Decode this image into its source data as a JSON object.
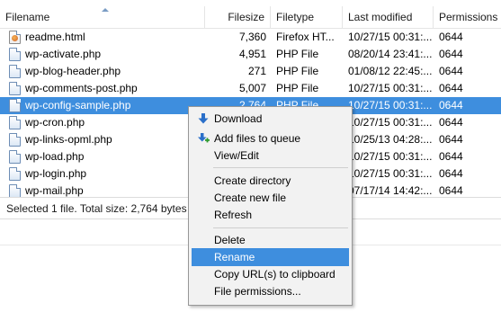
{
  "columns": {
    "filename": "Filename",
    "filesize": "Filesize",
    "filetype": "Filetype",
    "last_modified": "Last modified",
    "permissions": "Permissions"
  },
  "files": [
    {
      "name": "readme.html",
      "size": "7,360",
      "type": "Firefox HT...",
      "modified": "10/27/15 00:31:...",
      "perm": "0644",
      "icon": "html-file-icon"
    },
    {
      "name": "wp-activate.php",
      "size": "4,951",
      "type": "PHP File",
      "modified": "08/20/14 23:41:...",
      "perm": "0644",
      "icon": "php-file-icon"
    },
    {
      "name": "wp-blog-header.php",
      "size": "271",
      "type": "PHP File",
      "modified": "01/08/12 22:45:...",
      "perm": "0644",
      "icon": "php-file-icon"
    },
    {
      "name": "wp-comments-post.php",
      "size": "5,007",
      "type": "PHP File",
      "modified": "10/27/15 00:31:...",
      "perm": "0644",
      "icon": "php-file-icon"
    },
    {
      "name": "wp-config-sample.php",
      "size": "2,764",
      "type": "PHP File",
      "modified": "10/27/15 00:31:...",
      "perm": "0644",
      "icon": "php-file-icon"
    },
    {
      "name": "wp-cron.php",
      "size": "",
      "type": "",
      "modified": "10/27/15 00:31:...",
      "perm": "0644",
      "icon": "php-file-icon"
    },
    {
      "name": "wp-links-opml.php",
      "size": "",
      "type": "",
      "modified": "10/25/13 04:28:...",
      "perm": "0644",
      "icon": "php-file-icon"
    },
    {
      "name": "wp-load.php",
      "size": "",
      "type": "",
      "modified": "10/27/15 00:31:...",
      "perm": "0644",
      "icon": "php-file-icon"
    },
    {
      "name": "wp-login.php",
      "size": "",
      "type": "",
      "modified": "10/27/15 00:31:...",
      "perm": "0644",
      "icon": "php-file-icon"
    },
    {
      "name": "wp-mail.php",
      "size": "",
      "type": "",
      "modified": "07/17/14 14:42:...",
      "perm": "0644",
      "icon": "php-file-icon"
    }
  ],
  "selected_file": "wp-config-sample.php",
  "status": "Selected 1 file. Total size: 2,764 bytes",
  "context_menu": {
    "download": "Download",
    "add_to_queue": "Add files to queue",
    "view_edit": "View/Edit",
    "create_directory": "Create directory",
    "create_file": "Create new file",
    "refresh": "Refresh",
    "delete": "Delete",
    "rename": "Rename",
    "copy_urls": "Copy URL(s) to clipboard",
    "file_permissions": "File permissions...",
    "highlighted": "Rename"
  },
  "colors": {
    "selection": "#3e8ede",
    "menu_bg": "#f2f2f2"
  }
}
